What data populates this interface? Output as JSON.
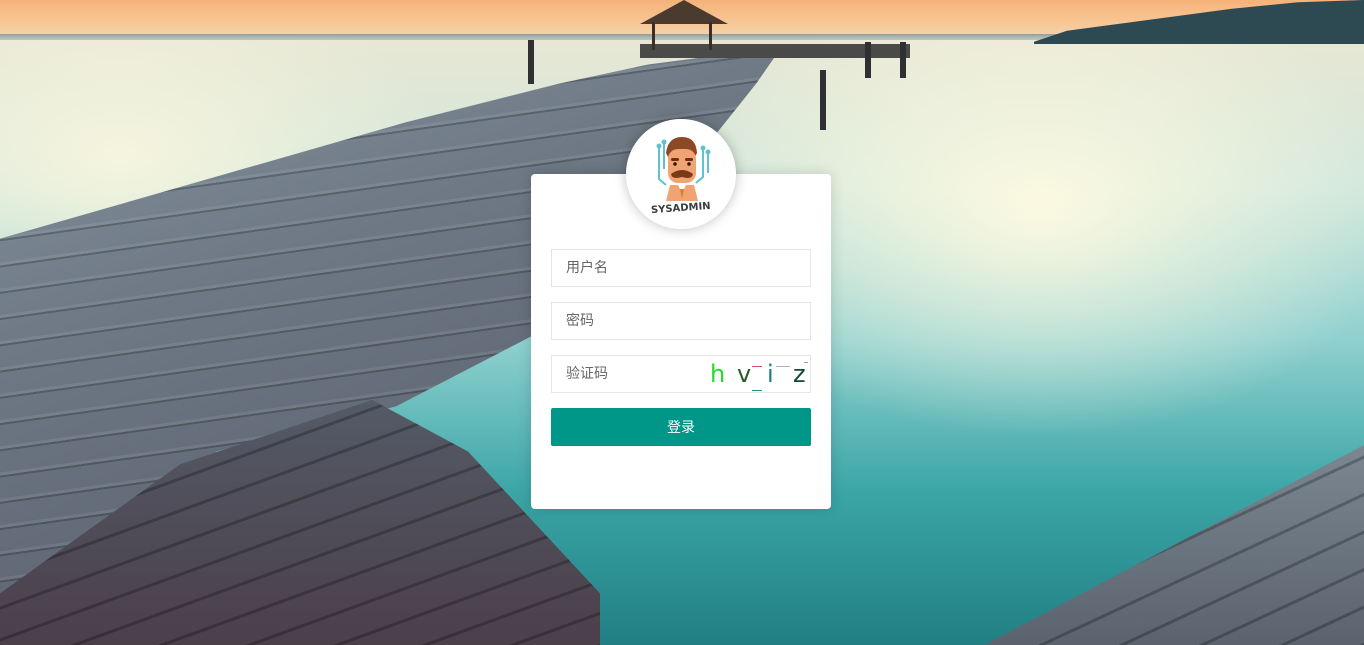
{
  "login": {
    "avatar_label": "SYSADMIN",
    "username": {
      "placeholder": "用户名",
      "value": ""
    },
    "password": {
      "placeholder": "密码",
      "value": ""
    },
    "captcha": {
      "placeholder": "验证码",
      "value": "",
      "chars": [
        {
          "char": "h",
          "color": "#22dd22"
        },
        {
          "char": "v",
          "color": "#2a5a30"
        },
        {
          "char": "i",
          "color": "#1e7b8c"
        },
        {
          "char": "z",
          "color": "#0f4a3a"
        }
      ]
    },
    "submit_label": "登录"
  },
  "colors": {
    "primary": "#009688",
    "card_background": "#ffffff",
    "input_border": "#e6e6e6"
  }
}
